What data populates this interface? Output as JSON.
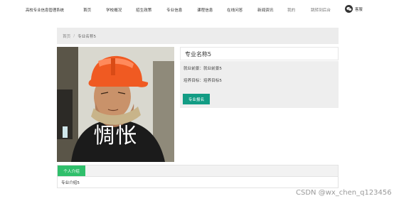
{
  "nav": {
    "brand": "高校专业信息管理系统",
    "items": [
      "首页",
      "学校概况",
      "招生政策",
      "专业信息",
      "课程信息",
      "在线问答",
      "新闻资讯",
      "我的",
      "跳转到后台"
    ],
    "wechat_label": "客服",
    "wechat_icon": "wechat-icon"
  },
  "breadcrumb": {
    "home": "首页",
    "separator": "/",
    "current": "专业名称5"
  },
  "photo": {
    "caption": "惆怅"
  },
  "info": {
    "title": "专业名称5",
    "employment_label": "就业前景：",
    "employment_value": "就业前景5",
    "goal_label": "培养目标：",
    "goal_value": "培养目标5",
    "apply_button": "专业报名"
  },
  "tabs": {
    "active": "个人介绍",
    "content": "专业介绍5"
  },
  "watermark": "CSDN @wx_chen_q123456",
  "colors": {
    "accent_teal": "#129c84",
    "tab_green": "#2fbf6b"
  }
}
